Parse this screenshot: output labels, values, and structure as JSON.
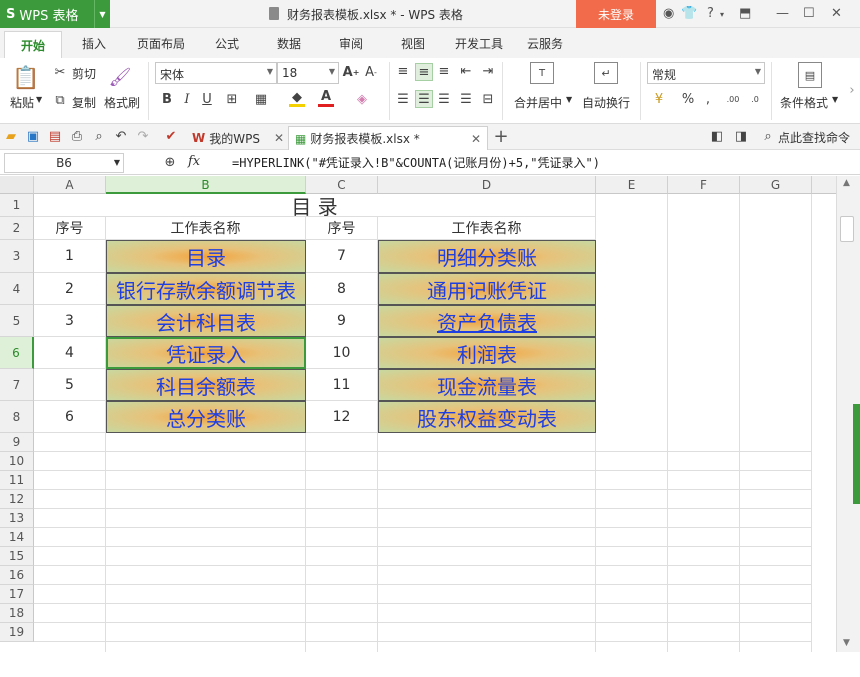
{
  "titlebar": {
    "app_logo": "S",
    "app_name": "WPS 表格",
    "window_title": "财务报表模板.xlsx * - WPS 表格",
    "login": "未登录"
  },
  "menu_tabs": [
    "开始",
    "插入",
    "页面布局",
    "公式",
    "数据",
    "审阅",
    "视图",
    "开发工具",
    "云服务"
  ],
  "ribbon": {
    "paste": "粘贴",
    "cut": "剪切",
    "copy": "复制",
    "format_painter": "格式刷",
    "font_name": "宋体",
    "font_size": "18",
    "number_format": "常规",
    "merge": "合并居中",
    "wrap": "自动换行",
    "conditional": "条件格式"
  },
  "doc_tabs": {
    "home": "我的WPS",
    "file": "财务报表模板.xlsx *",
    "search": "点此查找命令"
  },
  "formula_bar": {
    "name_box": "B6",
    "fx": "fx",
    "formula": "=HYPERLINK(\"#凭证录入!B\"&COUNTA(记账月份)+5,\"凭证录入\")"
  },
  "columns": [
    "A",
    "B",
    "C",
    "D",
    "E",
    "F",
    "G"
  ],
  "rows": [
    "1",
    "2",
    "3",
    "4",
    "5",
    "6",
    "7",
    "8",
    "9",
    "10",
    "11",
    "12",
    "13",
    "14",
    "15",
    "16",
    "17",
    "18",
    "19"
  ],
  "sheet": {
    "title": "目  录",
    "headers": {
      "a": "序号",
      "b": "工作表名称",
      "c": "序号",
      "d": "工作表名称"
    },
    "left": [
      {
        "no": "1",
        "name": "目录"
      },
      {
        "no": "2",
        "name": "银行存款余额调节表"
      },
      {
        "no": "3",
        "name": "会计科目表"
      },
      {
        "no": "4",
        "name": "凭证录入"
      },
      {
        "no": "5",
        "name": "科目余额表"
      },
      {
        "no": "6",
        "name": "总分类账"
      }
    ],
    "right": [
      {
        "no": "7",
        "name": "明细分类账"
      },
      {
        "no": "8",
        "name": "通用记账凭证"
      },
      {
        "no": "9",
        "name": "资产负债表"
      },
      {
        "no": "10",
        "name": "利润表"
      },
      {
        "no": "11",
        "name": "现金流量表"
      },
      {
        "no": "12",
        "name": "股东权益变动表"
      }
    ]
  },
  "colors": {
    "accent": "#3c9a3c",
    "login_bg": "#f26b4a",
    "link": "#1f3fe0"
  }
}
